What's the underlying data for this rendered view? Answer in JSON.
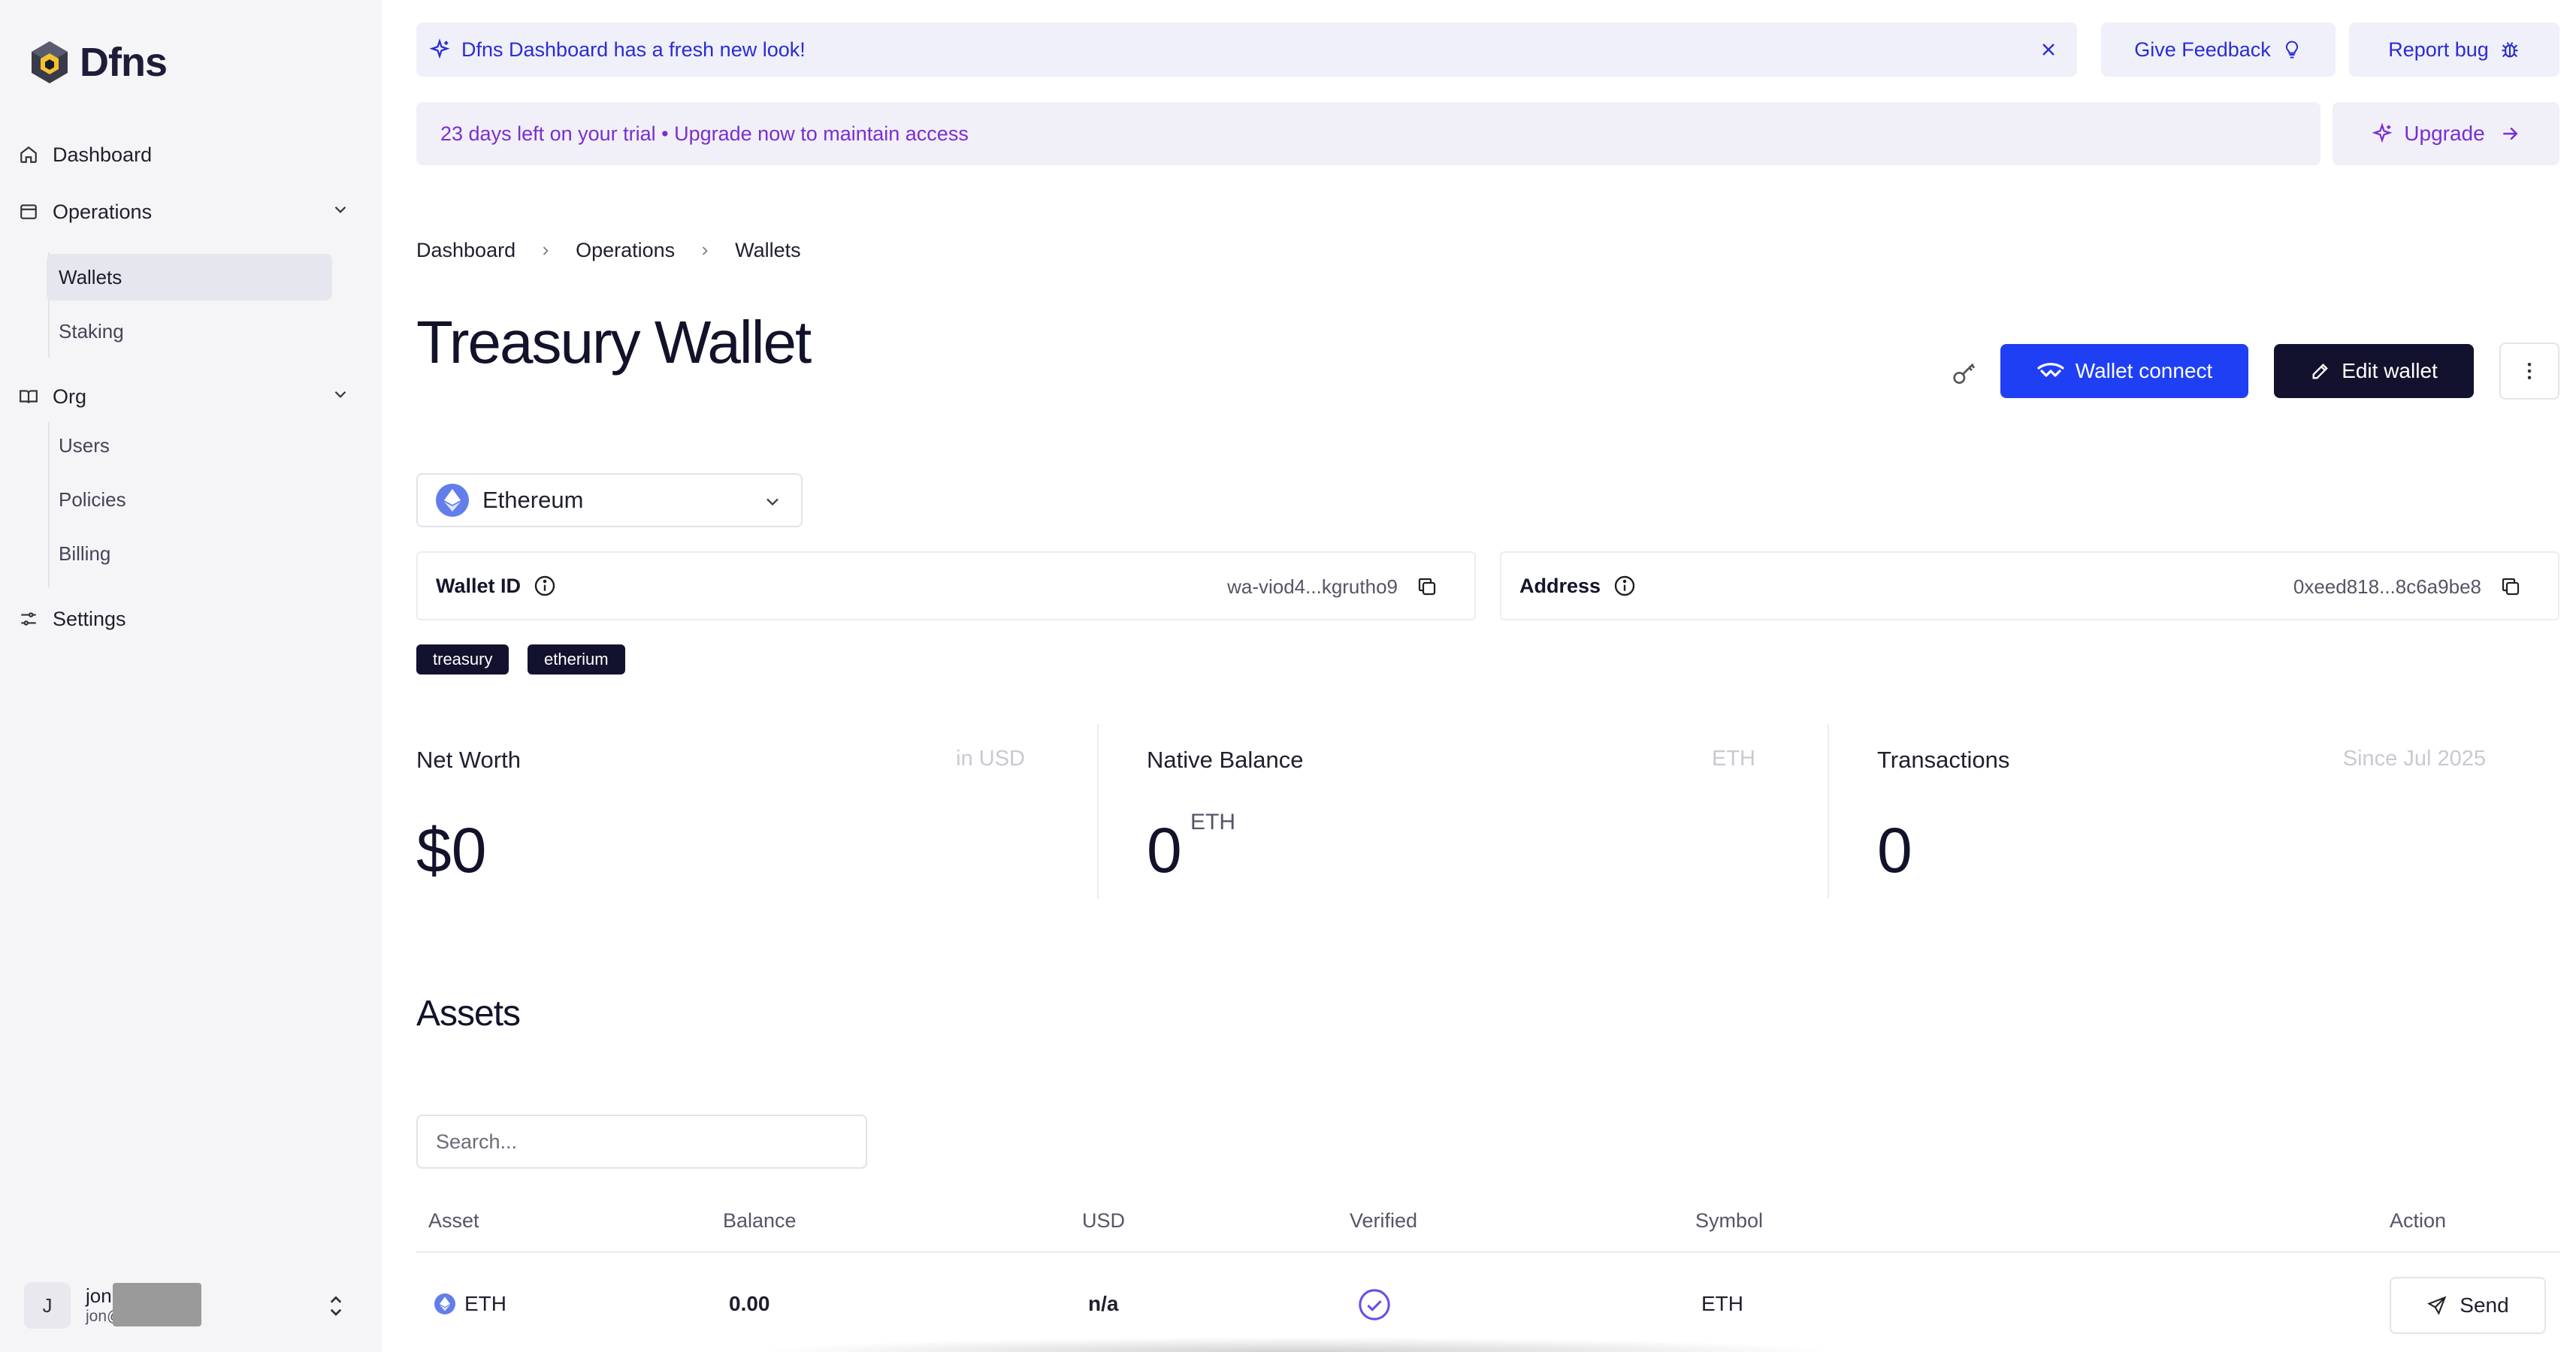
{
  "app": {
    "name": "Dfns"
  },
  "sidebar": {
    "dashboard": "Dashboard",
    "operations": "Operations",
    "operations_items": [
      "Wallets",
      "Staking"
    ],
    "org": "Org",
    "org_items": [
      "Users",
      "Policies",
      "Billing"
    ],
    "settings": "Settings",
    "user": {
      "initial": "J",
      "name": "jon@dfns.co",
      "email": "jon@dfns.co"
    }
  },
  "banners": {
    "announcement": "Dfns Dashboard has a fresh new look!",
    "feedback_label": "Give Feedback",
    "report_bug_label": "Report bug",
    "trial": "23 days left on your trial • Upgrade now to maintain access",
    "upgrade_label": "Upgrade"
  },
  "breadcrumb": [
    "Dashboard",
    "Operations",
    "Wallets"
  ],
  "wallet": {
    "title": "Treasury Wallet",
    "wallet_connect_label": "Wallet connect",
    "edit_label": "Edit wallet",
    "network": "Ethereum",
    "wallet_id_label": "Wallet ID",
    "wallet_id_value": "wa-viod4...kgrutho9",
    "address_label": "Address",
    "address_value": "0xeed818...8c6a9be8",
    "tags": [
      "treasury",
      "etherium"
    ]
  },
  "stats": {
    "net_worth": {
      "title": "Net Worth",
      "hint": "in USD",
      "value": "$0"
    },
    "native_balance": {
      "title": "Native Balance",
      "hint": "ETH",
      "value": "0",
      "unit": "ETH"
    },
    "transactions": {
      "title": "Transactions",
      "hint": "Since Jul 2025",
      "value": "0"
    }
  },
  "assets": {
    "title": "Assets",
    "search_placeholder": "Search...",
    "columns": [
      "Asset",
      "Balance",
      "USD",
      "Verified",
      "Symbol",
      "Action"
    ],
    "rows": [
      {
        "asset": "ETH",
        "balance": "0.00",
        "usd": "n/a",
        "verified": true,
        "symbol": "ETH",
        "action": "Send"
      }
    ]
  },
  "colors": {
    "primary": "#1f3ff5",
    "dark": "#13122e",
    "accent_purple": "#7a2fd0",
    "link_blue": "#2b2bd6",
    "eth": "#627eea"
  }
}
